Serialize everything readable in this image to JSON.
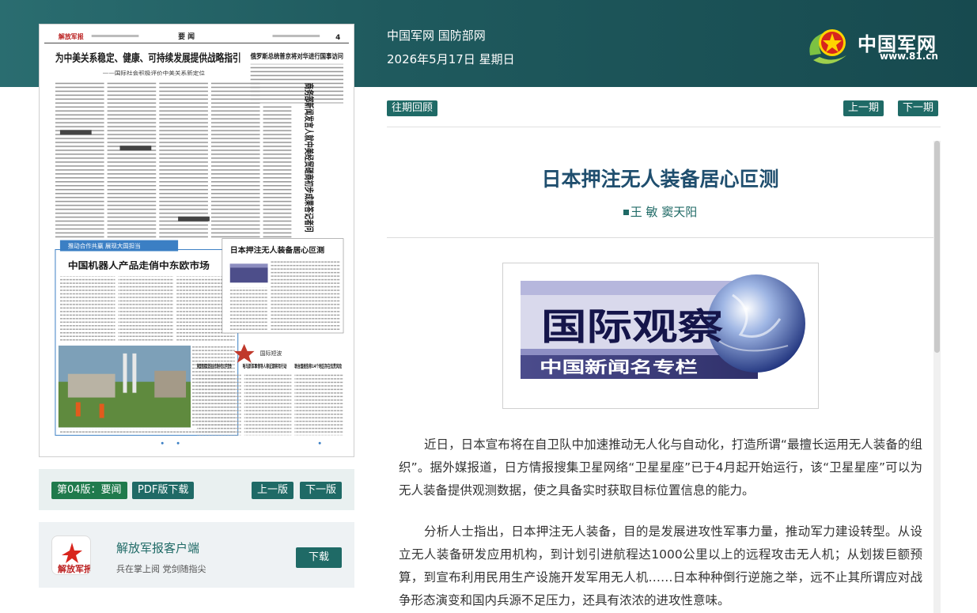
{
  "header": {
    "site": "中国军网 国防部网",
    "date": "2026年5月17日 星期日",
    "brand": "中国军网",
    "url": "www.81.cn"
  },
  "paper": {
    "masthead": "解放军报",
    "section": "要 闻",
    "page_no": "4",
    "headline1": "为中美关系稳定、健康、可持续发展提供战略指引",
    "subhead1": "——国际社会积极评价中美关系新定位",
    "headline2": "俄罗斯总统普京将对华进行国事访问",
    "vertical_headline": "商务部新闻发言人就中美经贸磋商初步成果答记者问",
    "block_label": "推动合作共赢 展现大国担当",
    "headline3": "中国机器人产品走俏中东欧市场",
    "headline4": "日本押注无人装备居心叵测",
    "headline5": "美国竞相取消自由市场中的公平竞争",
    "headline6": "哈马斯军事领导人称近期将有行动",
    "headline7": "联合国报告称14个地区存在饥荒风险",
    "intl_tag": "国际短波"
  },
  "page_bar": {
    "edition": "第04版：要闻",
    "pdf": "PDF版下载",
    "prev": "上一版",
    "next": "下一版"
  },
  "app": {
    "title": "解放军报客户端",
    "subtitle": "兵在掌上阅 党剑随指尖",
    "download": "下载"
  },
  "toolbar": {
    "archive": "往期回顾",
    "prev_issue": "上一期",
    "next_issue": "下一期"
  },
  "article": {
    "title": "日本押注无人装备居心叵测",
    "author": "王  敏  窦天阳",
    "image_main": "国际观察",
    "image_sub": "中国新闻名专栏",
    "p1": "近日，日本宣布将在自卫队中加速推动无人化与自动化，打造所谓“最擅长运用无人装备的组织”。据外媒报道，日方情报搜集卫星网络“卫星星座”已于4月起开始运行，该“卫星星座”可以为无人装备提供观测数据，使之具备实时获取目标位置信息的能力。",
    "p2": "分析人士指出，日本押注无人装备，目的是发展进攻性军事力量，推动军力建设转型。从设立无人装备研发应用机构，到计划引进航程达1000公里以上的远程攻击无人机；从划拨巨额预算，到宣布利用民用生产设施开发军用无人机……日本种种倒行逆施之举，远不止其所谓应对战争形态演变和国内兵源不足压力，还具有浓浓的进攻性意味。"
  },
  "colors": {
    "accent": "#1f6a66",
    "header": "#1f5a5e",
    "title": "#1f4e6e"
  }
}
